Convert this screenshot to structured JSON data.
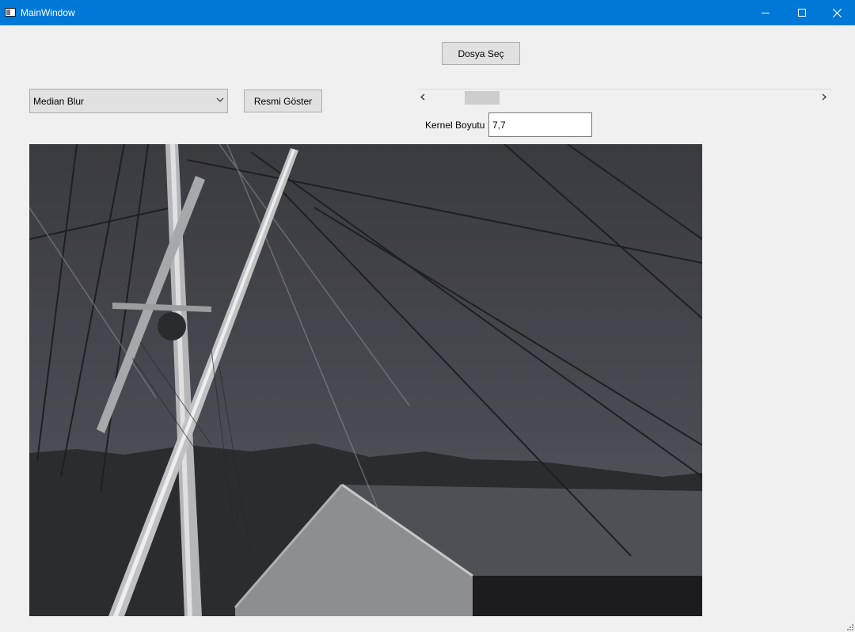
{
  "window": {
    "title": "MainWindow"
  },
  "controls": {
    "file_button_label": "Dosya Seç",
    "filter_selected": "Median Blur",
    "show_button_label": "Resmi Göster",
    "kernel_label": "Kernel Boyutu :",
    "kernel_value": "7,7",
    "slider_position": 0.09
  },
  "icons": [
    "app-icon",
    "minimize-icon",
    "maximize-icon",
    "close-icon",
    "chevron-down-icon",
    "chevron-left-icon",
    "chevron-right-icon",
    "resize-grip-icon"
  ],
  "colors": {
    "titlebar": "#0078d7",
    "window_bg": "#f0f0f0"
  }
}
